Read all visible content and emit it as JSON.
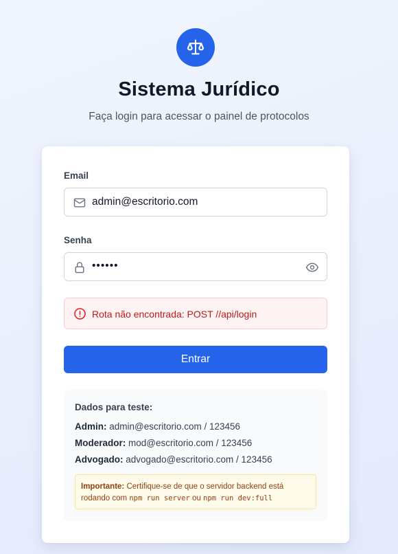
{
  "app": {
    "title": "Sistema Jurídico",
    "subtitle": "Faça login para acessar o painel de protocolos",
    "logo_icon": "scale-balance-icon",
    "accent_color": "#2563eb"
  },
  "form": {
    "email": {
      "label": "Email",
      "value": "admin@escritorio.com",
      "icon": "mail-icon"
    },
    "password": {
      "label": "Senha",
      "value": "••••••",
      "icon": "lock-icon",
      "toggle_icon": "eye-icon"
    },
    "error": {
      "text": "Rota não encontrada: POST //api/login",
      "icon": "alert-circle-icon",
      "color": "#b91c1c"
    },
    "submit_label": "Entrar"
  },
  "test_data": {
    "title": "Dados para teste:",
    "accounts": [
      {
        "role": "Admin:",
        "creds": "admin@escritorio.com / 123456"
      },
      {
        "role": "Moderador:",
        "creds": "mod@escritorio.com / 123456"
      },
      {
        "role": "Advogado:",
        "creds": "advogado@escritorio.com / 123456"
      }
    ],
    "note": {
      "strong": "Importante:",
      "text_1": "Certifique-se de que o servidor backend está",
      "text_2": "rodando com",
      "code_1": "npm run server",
      "text_3": "ou",
      "code_2": "npm run dev:full"
    }
  }
}
